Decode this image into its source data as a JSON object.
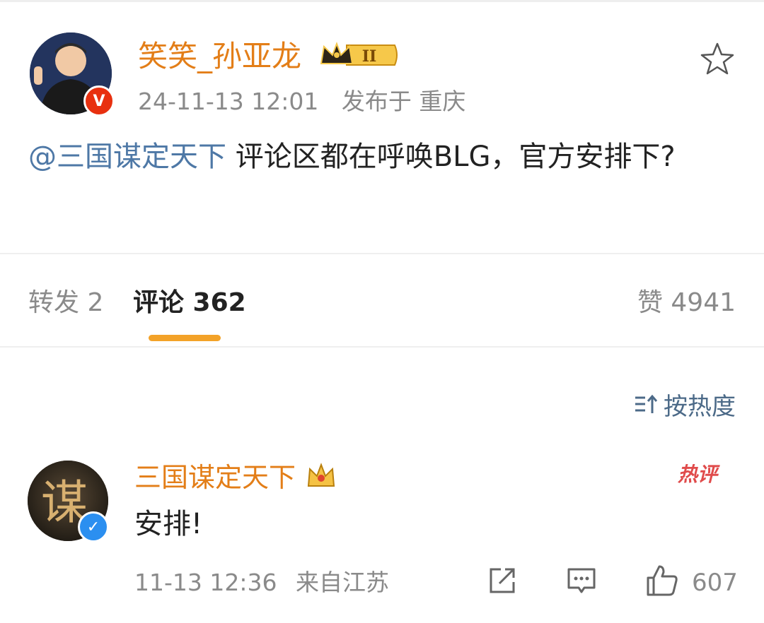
{
  "post": {
    "author": "笑笑_孙亚龙",
    "level_badge": "II",
    "time": "24-11-13 12:01",
    "location": "发布于 重庆",
    "mention": "@三国谋定天下",
    "text": " 评论区都在呼唤BLG，官方安排下?"
  },
  "tabs": {
    "repost": "转发 2",
    "comment": "评论 362",
    "like": "赞 4941"
  },
  "sort": {
    "label": "按热度"
  },
  "comment": {
    "author": "三国谋定天下",
    "hot_label": "热评",
    "text": "安排!",
    "time": "11-13 12:36",
    "location": "来自江苏",
    "likes": "607",
    "avatar_glyph": "谋"
  },
  "colors": {
    "name_orange": "#e37e18",
    "mention_blue": "#4e78a6",
    "accent_tab": "#f3a228",
    "verified_red": "#e8300f",
    "verified_blue": "#2b8ff0"
  },
  "icons": {
    "favorite": "star-icon",
    "sort": "sort-icon",
    "share": "share-icon",
    "reply": "comment-icon",
    "like": "thumbs-up-icon"
  }
}
